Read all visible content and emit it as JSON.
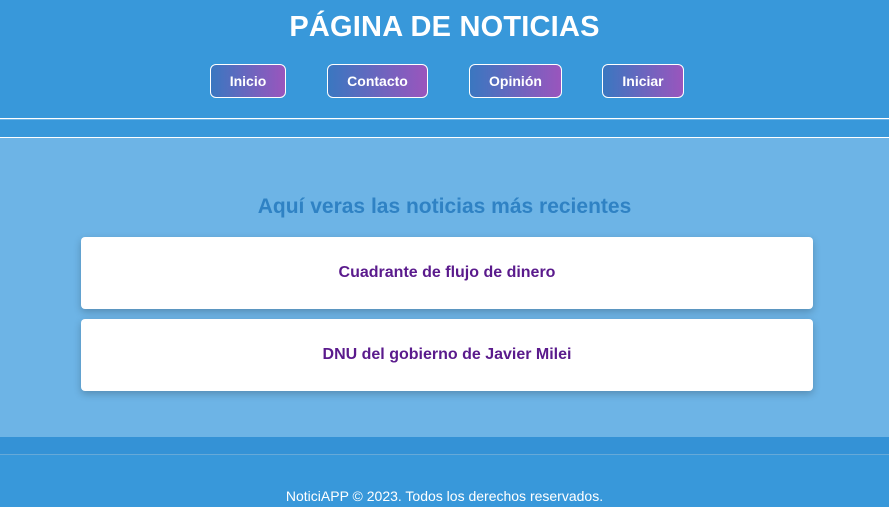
{
  "header": {
    "title": "PÁGINA DE NOTICIAS",
    "nav": [
      {
        "label": "Inicio"
      },
      {
        "label": "Contacto"
      },
      {
        "label": "Opinión"
      },
      {
        "label": "Iniciar"
      }
    ]
  },
  "main": {
    "section_title": "Aquí veras las noticias más recientes",
    "news": [
      {
        "title": "Cuadrante de flujo de dinero"
      },
      {
        "title": "DNU del gobierno de Javier Milei"
      }
    ]
  },
  "footer": {
    "text": "NoticiAPP © 2023. Todos los derechos reservados."
  },
  "colors": {
    "header_bg": "#3898da",
    "page_bg": "#6db4e6",
    "button_gradient_start": "#3a77c0",
    "button_gradient_end": "#9a55bd",
    "news_title": "#5a1a8c",
    "section_title": "#2f82c4"
  }
}
